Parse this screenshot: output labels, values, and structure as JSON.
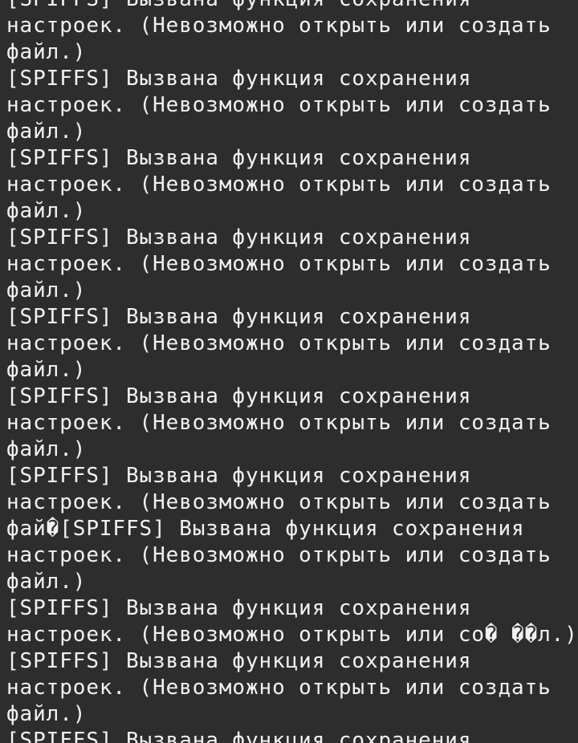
{
  "terminal": {
    "lines": [
      "[SPIFFS] Вызвана функция сохранения",
      "настроек. (Невозможно открыть или создать",
      "файл.)",
      "[SPIFFS] Вызвана функция сохранения",
      "настроек. (Невозможно открыть или создать",
      "файл.)",
      "[SPIFFS] Вызвана функция сохранения",
      "настроек. (Невозможно открыть или создать",
      "файл.)",
      "[SPIFFS] Вызвана функция сохранения",
      "настроек. (Невозможно открыть или создать",
      "файл.)",
      "[SPIFFS] Вызвана функция сохранения",
      "настроек. (Невозможно открыть или создать",
      "файл.)",
      "[SPIFFS] Вызвана функция сохранения",
      "настроек. (Невозможно открыть или создать",
      "файл.)",
      "[SPIFFS] Вызвана функция сохранения",
      "настроек. (Невозможно открыть или создать",
      "фай�[SPIFFS] Вызвана функция сохранения",
      "настроек. (Невозможно открыть или создать",
      "файл.)",
      "[SPIFFS] Вызвана функция сохранения",
      "настроек. (Невозможно открыть или со� ��л.)",
      "[SPIFFS] Вызвана функция сохранения",
      "настроек. (Невозможно открыть или создать",
      "файл.)",
      "[SPIFFS] Вызвана функция сохранения"
    ]
  }
}
